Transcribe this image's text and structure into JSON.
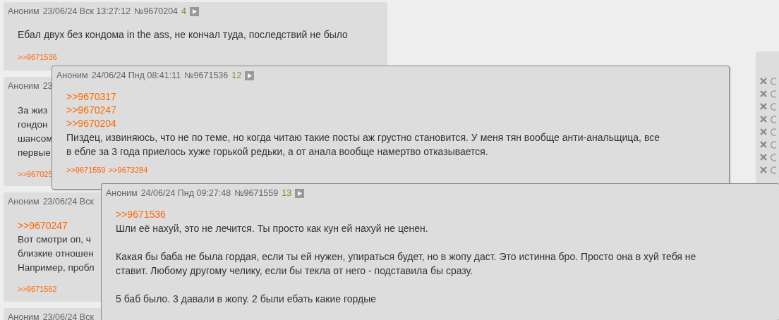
{
  "thread_posts": [
    {
      "author": "Аноним",
      "date": "23/06/24 Вск 13:27:12",
      "number": "№9670204",
      "reply_count": "4",
      "body": [
        {
          "kind": "text",
          "text": "Ебал двух без кондома in the ass, не кончал туда, последствий не было"
        }
      ],
      "replies": [
        ">>9671536"
      ]
    },
    {
      "author": "Аноним",
      "date": "23",
      "body": [
        {
          "kind": "text",
          "text": "За жиз\nгондон\nшансом\nпервые"
        }
      ],
      "replies": [
        ">>967025"
      ]
    },
    {
      "author": "Аноним",
      "date": "23/06/24 Вск",
      "body": [
        {
          "kind": "link",
          "text": ">>9670247"
        },
        {
          "kind": "text",
          "text": "Вот смотри оп, ч\nблизкие отношен\nНапример, пробл"
        }
      ],
      "replies": [
        ">>9671562"
      ]
    },
    {
      "author": "Аноним",
      "date": "23/06/24 Вск"
    }
  ],
  "popups": [
    {
      "author": "Аноним",
      "date": "24/06/24 Пнд 08:41:11",
      "number": "№9671536",
      "reply_count": "12",
      "body": [
        {
          "kind": "link",
          "text": ">>9670317"
        },
        {
          "kind": "link",
          "text": ">>9670247"
        },
        {
          "kind": "link",
          "text": ">>9670204"
        },
        {
          "kind": "text",
          "text": "Пиздец, извиняюсь, что не по теме, но когда читаю такие посты аж грустно становится. У меня тян вообще анти-анальщица, все\nв ебле за 3 года приелось хуже горькой редьки, а от анала вообще намертво отказывается."
        }
      ],
      "replies": [
        ">>9671559",
        ">>9673284"
      ]
    },
    {
      "author": "Аноним",
      "date": "24/06/24 Пнд 09:27:48",
      "number": "№9671559",
      "reply_count": "13",
      "body": [
        {
          "kind": "link",
          "text": ">>9671536"
        },
        {
          "kind": "text",
          "text": "Шли её нахуй, это не лечится. Ты просто как кун ей нахуй не ценен.\n\nКакая бы баба не была гордая, если ты ей нужен, упираться будет, но в жопу даст. Это истинна бро. Просто она в хуй тебя не\nставит. Любому другому челику, если бы текла от него - подставила бы сразу.\n\n5 баб было. 3 давали в жопу. 2 были ебать какие гордые"
        }
      ]
    }
  ]
}
